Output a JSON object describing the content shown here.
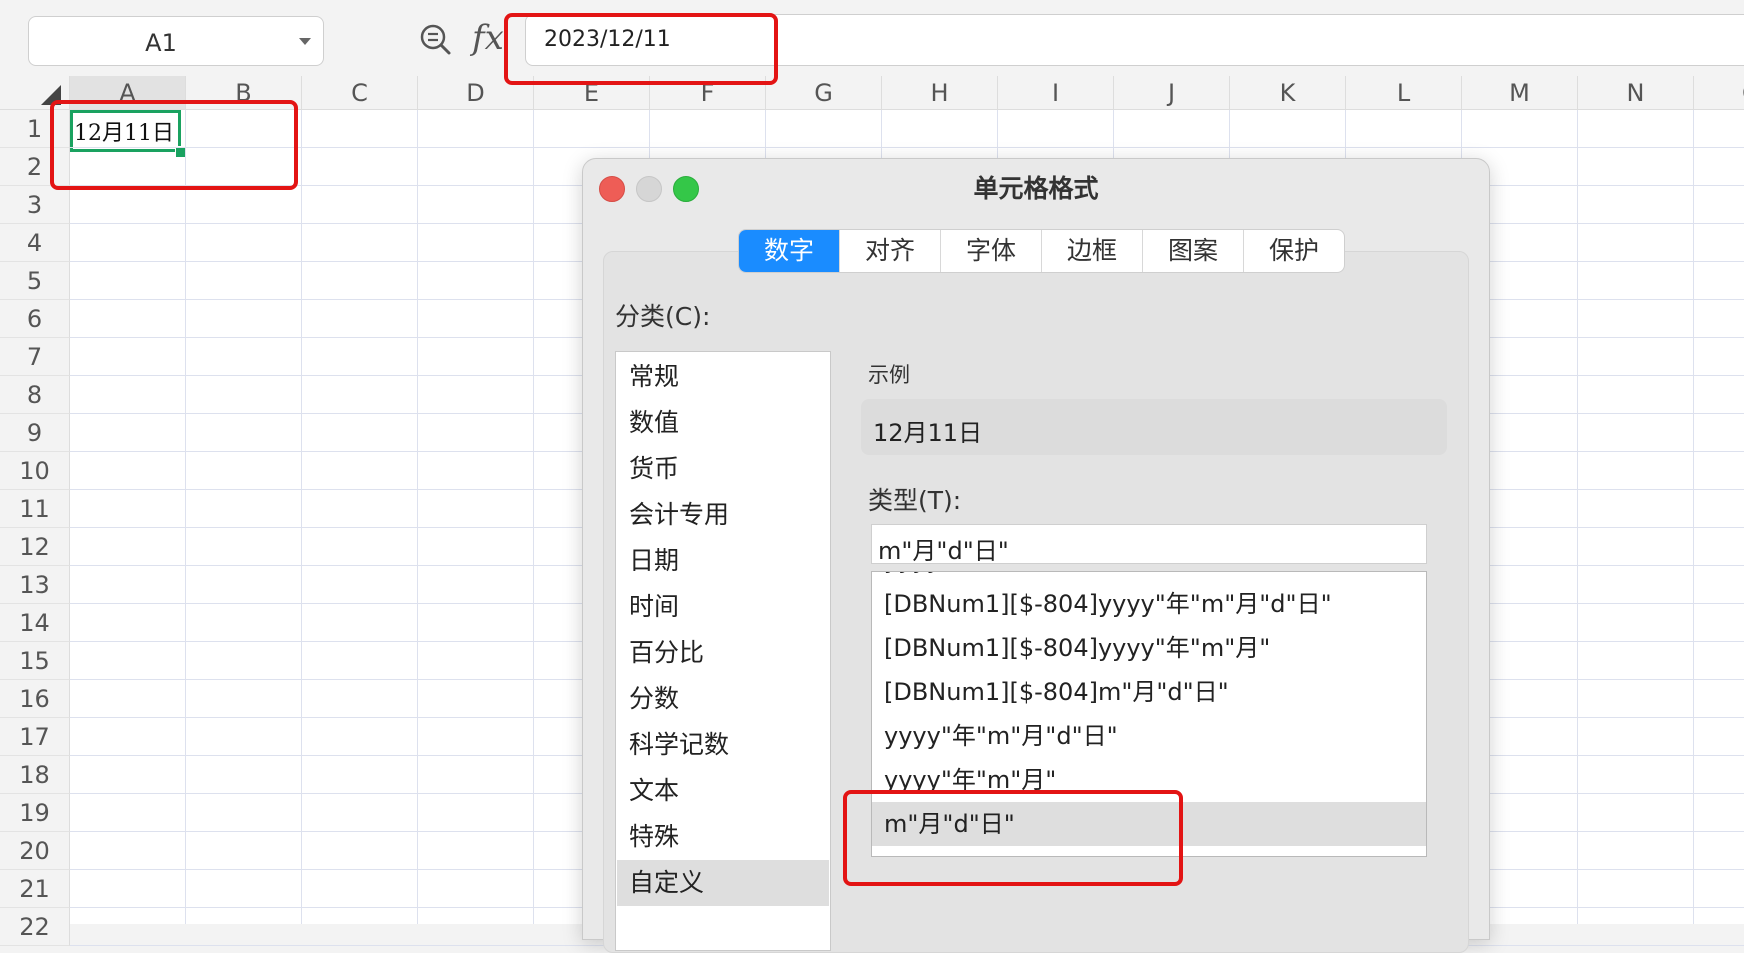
{
  "namebox": {
    "value": "A1"
  },
  "formula_bar": {
    "fx": "fx",
    "value": "2023/12/11"
  },
  "grid": {
    "columns": [
      "A",
      "B",
      "C",
      "D",
      "E",
      "F",
      "G",
      "H",
      "I",
      "J",
      "K",
      "L",
      "M",
      "N",
      "O"
    ],
    "rows": [
      "1",
      "2",
      "3",
      "4",
      "5",
      "6",
      "7",
      "8",
      "9",
      "10",
      "11",
      "12",
      "13",
      "14",
      "15",
      "16",
      "17",
      "18",
      "19",
      "20",
      "21",
      "22"
    ],
    "active_cell": "A1",
    "cell_a1": "12月11日"
  },
  "dialog": {
    "title": "单元格格式",
    "tabs": [
      "数字",
      "对齐",
      "字体",
      "边框",
      "图案",
      "保护"
    ],
    "active_tab": "数字",
    "category_label": "分类(C):",
    "categories": [
      "常规",
      "数值",
      "货币",
      "会计专用",
      "日期",
      "时间",
      "百分比",
      "分数",
      "科学记数",
      "文本",
      "特殊",
      "自定义"
    ],
    "selected_category": "自定义",
    "sample_label": "示例",
    "sample_value": "12月11日",
    "type_label": "类型(T):",
    "type_value": "m\"月\"d\"日\"",
    "type_list": [
      "yyyy/m/d",
      "[DBNum1][$-804]yyyy\"年\"m\"月\"d\"日\"",
      "[DBNum1][$-804]yyyy\"年\"m\"月\"",
      "[DBNum1][$-804]m\"月\"d\"日\"",
      "yyyy\"年\"m\"月\"d\"日\"",
      "yyyy\"年\"m\"月\"",
      "m\"月\"d\"日\""
    ],
    "selected_type": "m\"月\"d\"日\""
  },
  "colors": {
    "accent": "#1a8cff",
    "active_cell_border": "#1aa260",
    "annotation_red": "#e31414"
  }
}
